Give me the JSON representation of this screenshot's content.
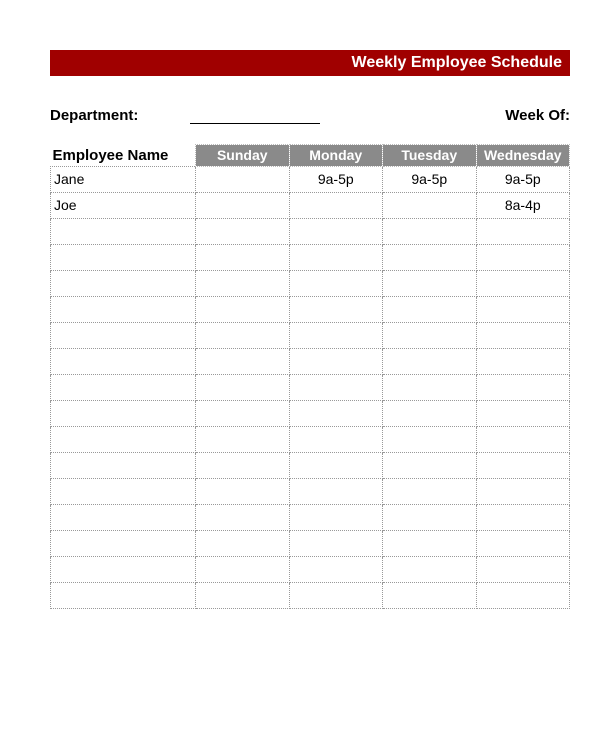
{
  "title": "Weekly Employee Schedule",
  "labels": {
    "department": "Department:",
    "week_of": "Week Of:",
    "employee_name": "Employee Name"
  },
  "days": [
    "Sunday",
    "Monday",
    "Tuesday",
    "Wednesday"
  ],
  "rows_block1": [
    {
      "name": "Jane",
      "shifts": [
        "",
        "9a-5p",
        "9a-5p",
        "9a-5p"
      ]
    },
    {
      "name": "Joe",
      "shifts": [
        "",
        "",
        "",
        "8a-4p"
      ]
    },
    {
      "name": "",
      "shifts": [
        "",
        "",
        "",
        ""
      ]
    },
    {
      "name": "",
      "shifts": [
        "",
        "",
        "",
        ""
      ]
    },
    {
      "name": "",
      "shifts": [
        "",
        "",
        "",
        ""
      ]
    },
    {
      "name": "",
      "shifts": [
        "",
        "",
        "",
        ""
      ]
    },
    {
      "name": "",
      "shifts": [
        "",
        "",
        "",
        ""
      ]
    },
    {
      "name": "",
      "shifts": [
        "",
        "",
        "",
        ""
      ]
    },
    {
      "name": "",
      "shifts": [
        "",
        "",
        "",
        ""
      ]
    },
    {
      "name": "",
      "shifts": [
        "",
        "",
        "",
        ""
      ]
    },
    {
      "name": "",
      "shifts": [
        "",
        "",
        "",
        ""
      ]
    }
  ],
  "rows_block2": [
    {
      "name": "",
      "shifts": [
        "",
        "",
        "",
        ""
      ]
    },
    {
      "name": "",
      "shifts": [
        "",
        "",
        "",
        ""
      ]
    },
    {
      "name": "",
      "shifts": [
        "",
        "",
        "",
        ""
      ]
    },
    {
      "name": "",
      "shifts": [
        "",
        "",
        "",
        ""
      ]
    },
    {
      "name": "",
      "shifts": [
        "",
        "",
        "",
        ""
      ]
    },
    {
      "name": "",
      "shifts": [
        "",
        "",
        "",
        ""
      ]
    }
  ]
}
